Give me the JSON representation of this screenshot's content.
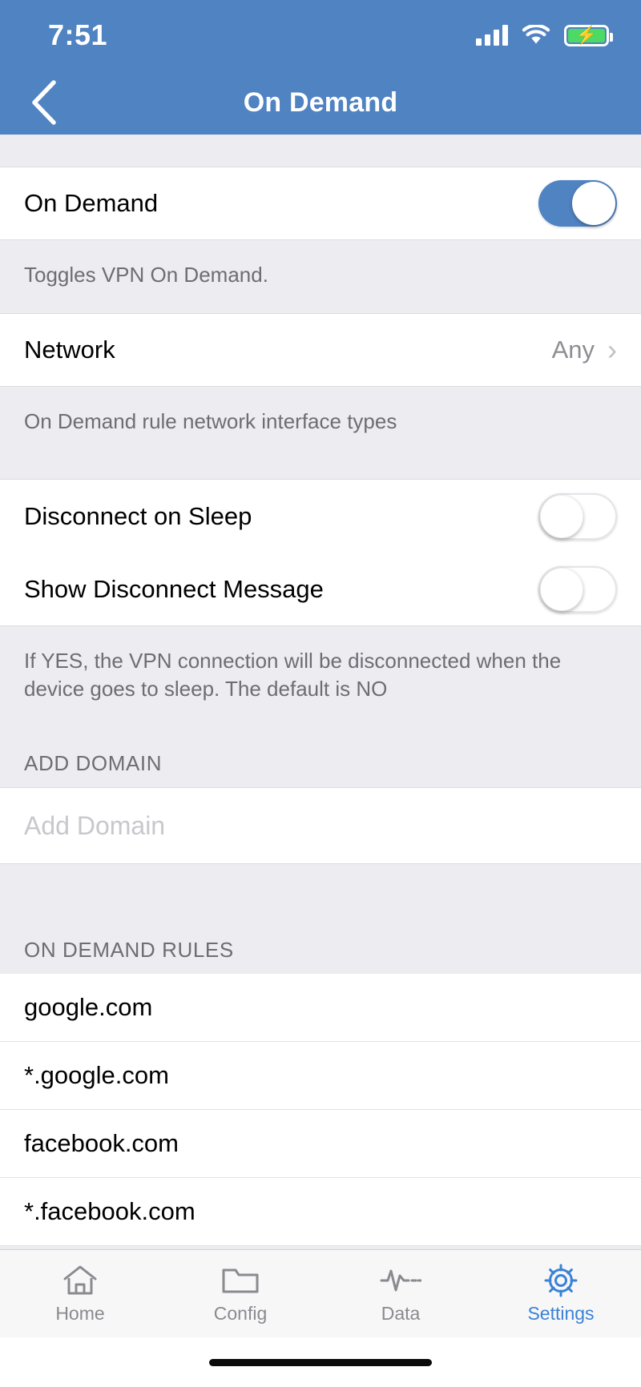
{
  "statusbar": {
    "time": "7:51",
    "signal_icon": "cellular-signal-icon",
    "wifi_icon": "wifi-icon",
    "battery_icon": "battery-charging-icon",
    "battery_color": "#4cd964"
  },
  "navbar": {
    "back_icon": "chevron-left-icon",
    "title": "On Demand",
    "bar_color": "#5083c2"
  },
  "sections": {
    "on_demand": {
      "title": "On Demand",
      "switch_state": "on",
      "footnote": "Toggles VPN On Demand."
    },
    "network": {
      "title": "Network",
      "value": "Any",
      "chevron_icon": "chevron-right-icon",
      "footnote": "On Demand rule network interface types"
    },
    "disconnect_on_sleep": {
      "title": "Disconnect on Sleep",
      "switch_state": "off"
    },
    "show_disconnect_message": {
      "title": "Show Disconnect Message",
      "switch_state": "off",
      "footnote": "If YES, the VPN connection will be disconnected when the device goes to sleep. The default is NO"
    },
    "add_domain": {
      "header": "ADD DOMAIN",
      "placeholder": "Add Domain",
      "value": ""
    },
    "on_demand_rules": {
      "header": "ON DEMAND RULES",
      "rules": [
        "google.com",
        "*.google.com",
        "facebook.com",
        "*.facebook.com"
      ]
    }
  },
  "tabbar": {
    "accent_color": "#3b82d6",
    "inactive_color": "#8a8a8f",
    "tabs": [
      {
        "label": "Home",
        "icon": "home-icon",
        "active": false
      },
      {
        "label": "Config",
        "icon": "folder-icon",
        "active": false
      },
      {
        "label": "Data",
        "icon": "pulse-waveform-icon",
        "active": false
      },
      {
        "label": "Settings",
        "icon": "gear-icon",
        "active": true
      }
    ]
  }
}
